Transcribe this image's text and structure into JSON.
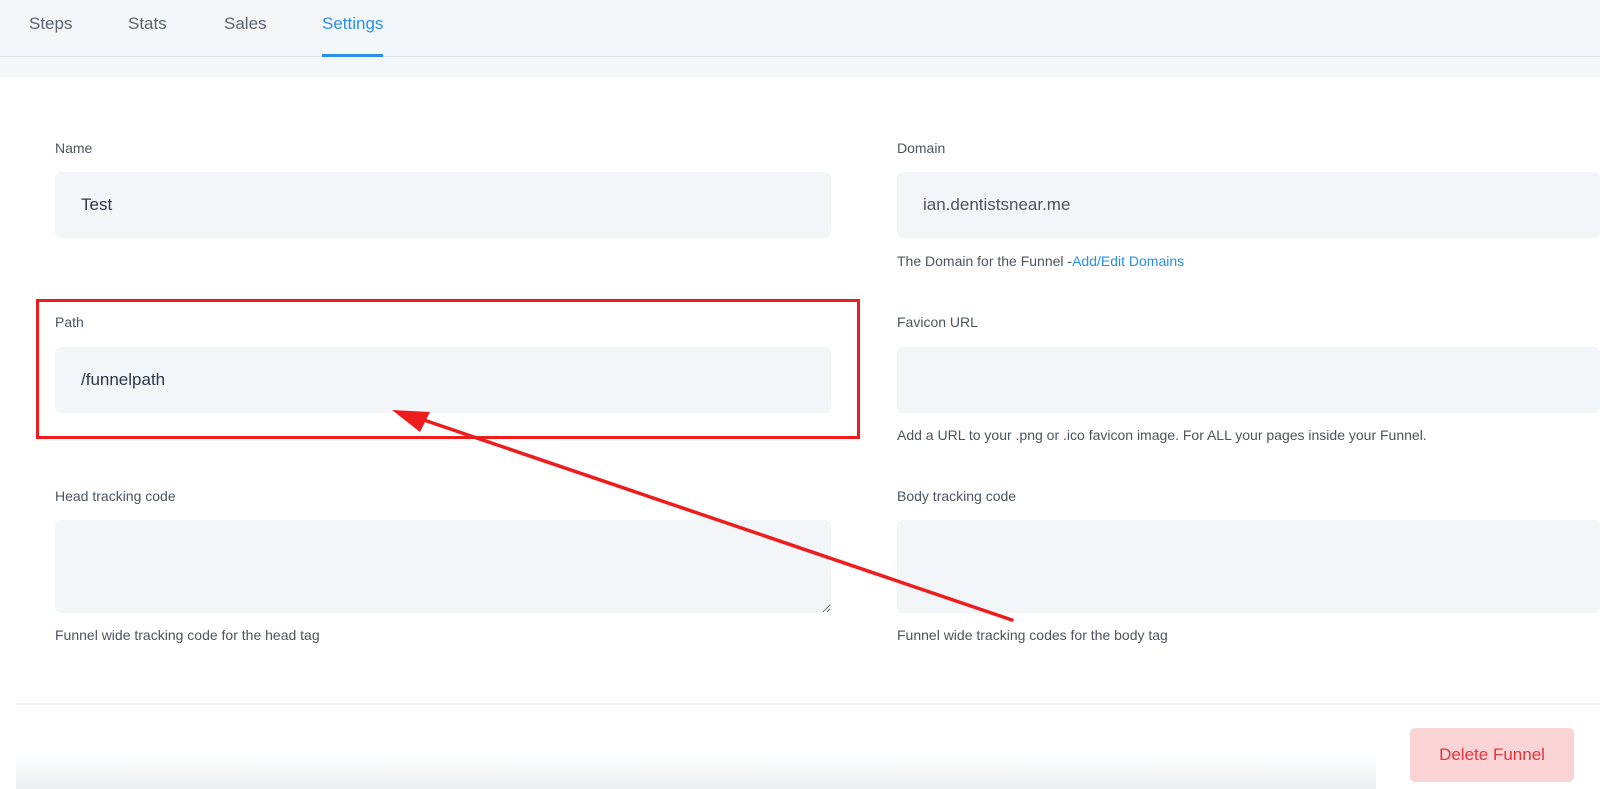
{
  "tabs": [
    {
      "label": "Steps",
      "active": false
    },
    {
      "label": "Stats",
      "active": false
    },
    {
      "label": "Sales",
      "active": false
    },
    {
      "label": "Settings",
      "active": true
    }
  ],
  "form": {
    "name": {
      "label": "Name",
      "value": "Test"
    },
    "domain": {
      "label": "Domain",
      "value": "ian.dentistsnear.me",
      "help_text": "The Domain for the Funnel -",
      "help_link": "Add/Edit Domains"
    },
    "path": {
      "label": "Path",
      "value": "/funnelpath"
    },
    "favicon": {
      "label": "Favicon URL",
      "value": "",
      "help_text": "Add a URL to your .png or .ico favicon image. For ALL your pages inside your Funnel."
    },
    "head_tracking": {
      "label": "Head tracking code",
      "value": "",
      "help_text": "Funnel wide tracking code for the head tag"
    },
    "body_tracking": {
      "label": "Body tracking code",
      "value": "",
      "help_text": "Funnel wide tracking codes for the body tag"
    }
  },
  "actions": {
    "delete_label": "Delete Funnel"
  },
  "colors": {
    "accent": "#2b8fe6",
    "danger": "#e5333d",
    "danger_bg": "#fad4d4",
    "annotation": "#ee1c1c",
    "field_bg": "#f2f6f9"
  }
}
